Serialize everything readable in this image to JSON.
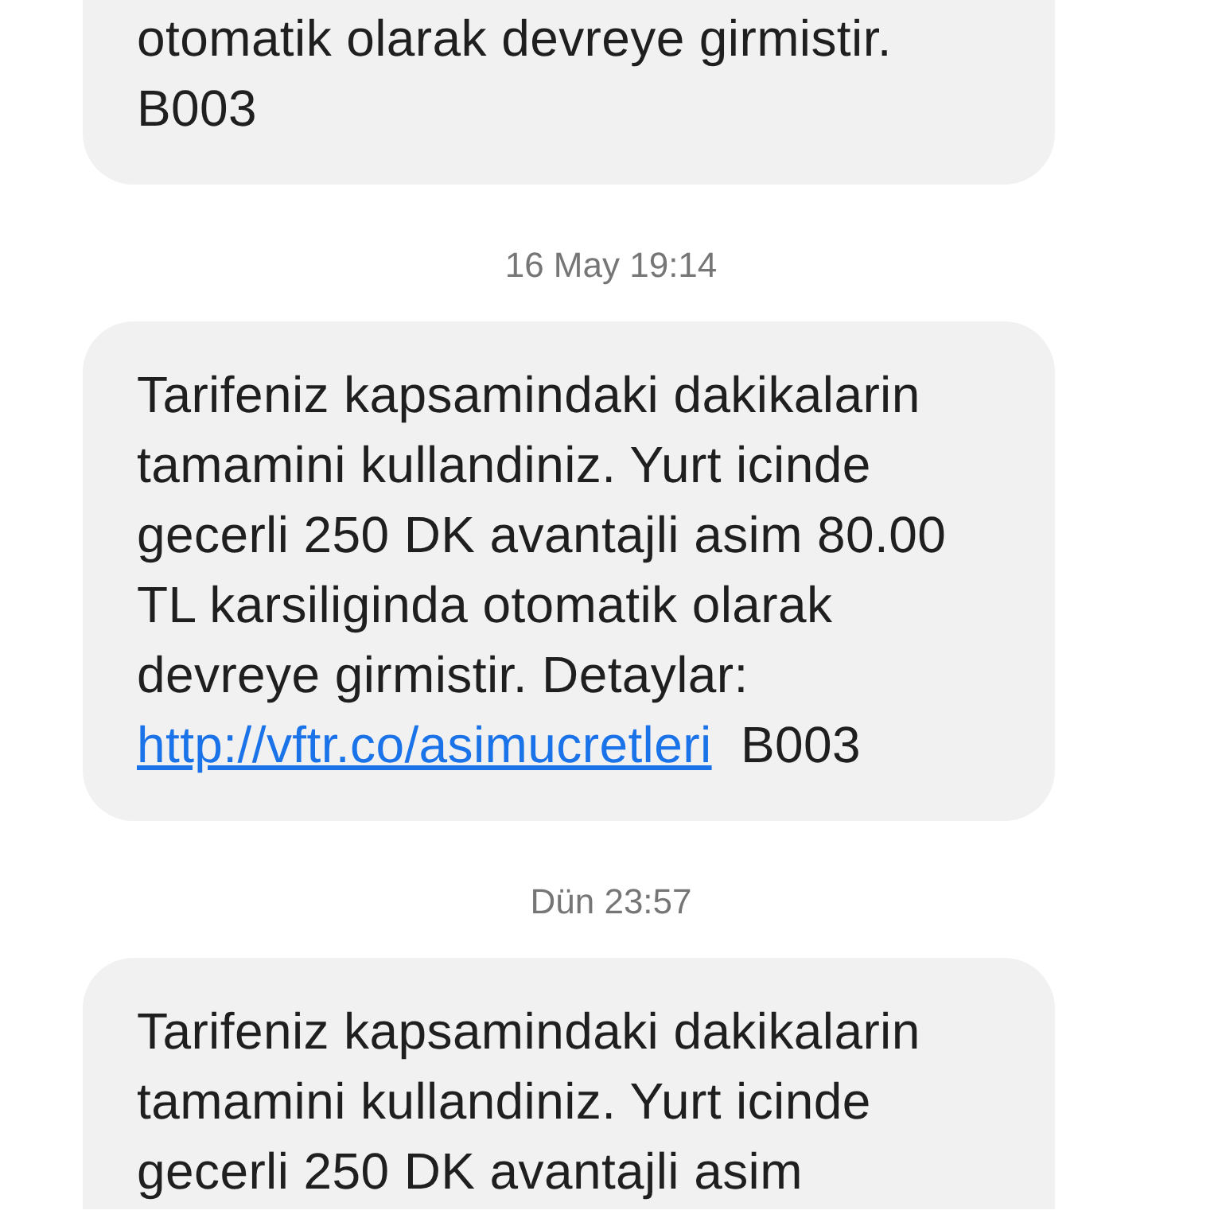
{
  "items": [
    {
      "kind": "message",
      "text": "otomatik olarak devreye girmistir.",
      "suffix": "B003",
      "cut_top": true
    },
    {
      "kind": "timestamp",
      "text": "16 May 19:14"
    },
    {
      "kind": "message",
      "text": "Tarifeniz kapsamindaki dakikalarin tamamini kullandiniz. Yurt icinde gecerli 250 DK avantajli asim 80.00 TL karsiliginda otomatik olarak devreye girmistir. Detaylar:",
      "link": "http://vftr.co/asimucretleri",
      "suffix": "B003"
    },
    {
      "kind": "timestamp",
      "text": "Dün 23:57"
    },
    {
      "kind": "message",
      "text": "Tarifeniz kapsamindaki dakikalarin tamamini kullandiniz. Yurt icinde gecerli 250 DK avantajli asim",
      "cut_bottom": true
    }
  ]
}
